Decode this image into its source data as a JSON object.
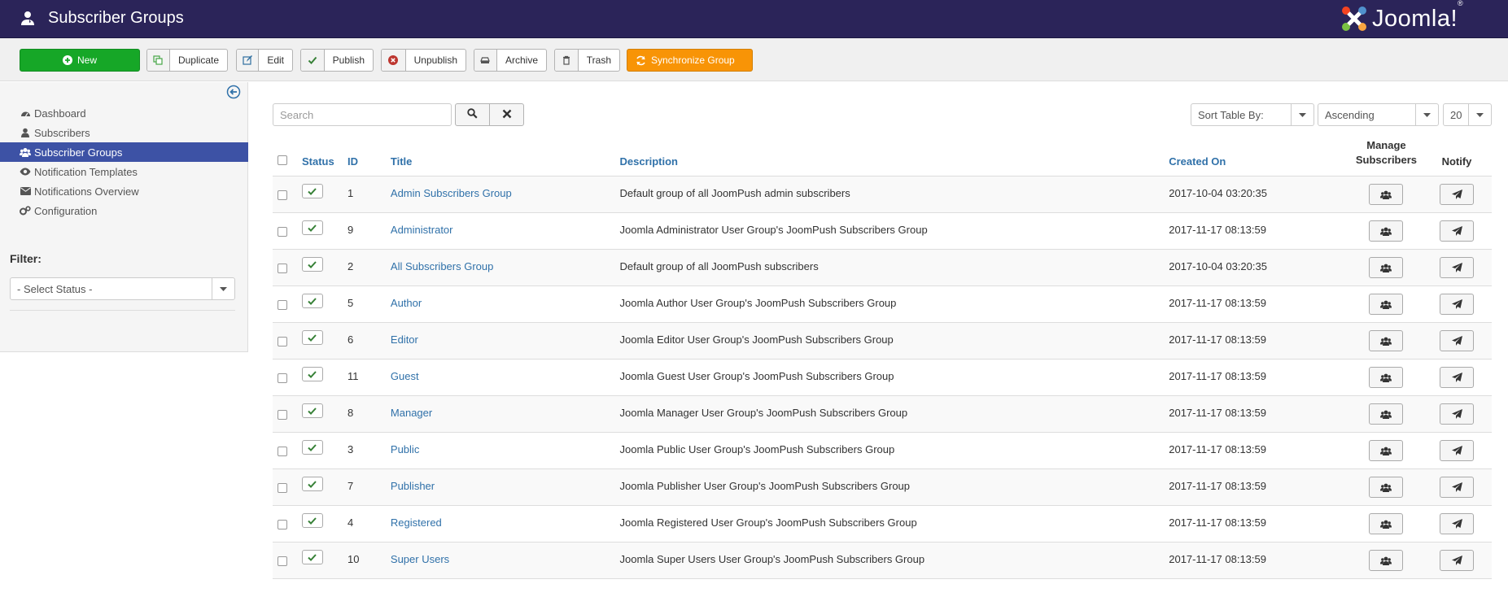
{
  "header": {
    "title": "Subscriber Groups",
    "logo_text": "Joomla!",
    "logo_reg": "®",
    "bg": "#2b2459"
  },
  "toolbar": {
    "new_label": "New",
    "duplicate_label": "Duplicate",
    "edit_label": "Edit",
    "publish_label": "Publish",
    "unpublish_label": "Unpublish",
    "archive_label": "Archive",
    "trash_label": "Trash",
    "sync_label": "Synchronize Group"
  },
  "sidebar": {
    "items": [
      {
        "label": "Dashboard",
        "icon": "dashboard-icon"
      },
      {
        "label": "Subscribers",
        "icon": "user-icon"
      },
      {
        "label": "Subscriber Groups",
        "icon": "users-icon",
        "active": true
      },
      {
        "label": "Notification Templates",
        "icon": "eye-icon"
      },
      {
        "label": "Notifications Overview",
        "icon": "envelope-icon"
      },
      {
        "label": "Configuration",
        "icon": "cogs-icon"
      }
    ],
    "filter_label": "Filter:",
    "status_select": "- Select Status -"
  },
  "search": {
    "placeholder": "Search"
  },
  "sort": {
    "sort_by": "Sort Table By:",
    "direction": "Ascending",
    "limit": "20"
  },
  "table": {
    "headers": {
      "status": "Status",
      "id": "ID",
      "title": "Title",
      "description": "Description",
      "created": "Created On",
      "manage": "Manage Subscribers",
      "notify": "Notify"
    },
    "rows": [
      {
        "id": "1",
        "title": "Admin Subscribers Group",
        "description": "Default group of all JoomPush admin subscribers",
        "created": "2017-10-04 03:20:35"
      },
      {
        "id": "9",
        "title": "Administrator",
        "description": "Joomla Administrator User Group's JoomPush Subscribers Group",
        "created": "2017-11-17 08:13:59"
      },
      {
        "id": "2",
        "title": "All Subscribers Group",
        "description": "Default group of all JoomPush subscribers",
        "created": "2017-10-04 03:20:35"
      },
      {
        "id": "5",
        "title": "Author",
        "description": "Joomla Author User Group's JoomPush Subscribers Group",
        "created": "2017-11-17 08:13:59"
      },
      {
        "id": "6",
        "title": "Editor",
        "description": "Joomla Editor User Group's JoomPush Subscribers Group",
        "created": "2017-11-17 08:13:59"
      },
      {
        "id": "11",
        "title": "Guest",
        "description": "Joomla Guest User Group's JoomPush Subscribers Group",
        "created": "2017-11-17 08:13:59"
      },
      {
        "id": "8",
        "title": "Manager",
        "description": "Joomla Manager User Group's JoomPush Subscribers Group",
        "created": "2017-11-17 08:13:59"
      },
      {
        "id": "3",
        "title": "Public",
        "description": "Joomla Public User Group's JoomPush Subscribers Group",
        "created": "2017-11-17 08:13:59"
      },
      {
        "id": "7",
        "title": "Publisher",
        "description": "Joomla Publisher User Group's JoomPush Subscribers Group",
        "created": "2017-11-17 08:13:59"
      },
      {
        "id": "4",
        "title": "Registered",
        "description": "Joomla Registered User Group's JoomPush Subscribers Group",
        "created": "2017-11-17 08:13:59"
      },
      {
        "id": "10",
        "title": "Super Users",
        "description": "Joomla Super Users User Group's JoomPush Subscribers Group",
        "created": "2017-11-17 08:13:59"
      }
    ]
  }
}
